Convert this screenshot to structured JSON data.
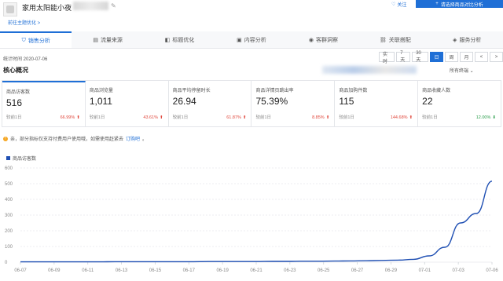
{
  "header": {
    "product_title": "家用太阳能小夜",
    "edit_icon": "edit-icon",
    "old_link": "前往主题优化 >",
    "follow_label": "关注",
    "compare_label": "请选择商品对比分析"
  },
  "tabs": [
    {
      "label": "销售分析",
      "icon": "shield-icon",
      "active": true
    },
    {
      "label": "流量来源",
      "icon": "flow-icon",
      "active": false
    },
    {
      "label": "标题优化",
      "icon": "tag-icon",
      "active": false
    },
    {
      "label": "内容分析",
      "icon": "content-icon",
      "active": false
    },
    {
      "label": "客群洞察",
      "icon": "people-icon",
      "active": false
    },
    {
      "label": "关联搭配",
      "icon": "link-icon",
      "active": false
    },
    {
      "label": "服务分析",
      "icon": "service-icon",
      "active": false
    }
  ],
  "toolbar": {
    "stat_time": "统计时间 2020-07-06",
    "ranges": [
      {
        "label": "实时",
        "active": false
      },
      {
        "label": "7天",
        "active": false
      },
      {
        "label": "30天",
        "active": false
      },
      {
        "label": "日",
        "active": true
      },
      {
        "label": "周",
        "active": false
      },
      {
        "label": "月",
        "active": false
      },
      {
        "label": "<",
        "active": false
      },
      {
        "label": ">",
        "active": false
      }
    ]
  },
  "section": {
    "title": "核心概况",
    "terminal_select": "所有终端 ⌄"
  },
  "metrics": [
    {
      "label": "商品访客数",
      "value": "516",
      "compare": "较前1日",
      "change": "66.99%",
      "dir": "up"
    },
    {
      "label": "商品浏览量",
      "value": "1,011",
      "compare": "较前1日",
      "change": "43.61%",
      "dir": "up"
    },
    {
      "label": "商品平均停留时长",
      "value": "26.94",
      "compare": "较前1日",
      "change": "61.87%",
      "dir": "up"
    },
    {
      "label": "商品详情页跳出率",
      "value": "75.39%",
      "compare": "较前1日",
      "change": "8.85%",
      "dir": "up"
    },
    {
      "label": "商品加购件数",
      "value": "115",
      "compare": "较前1日",
      "change": "144.68%",
      "dir": "up"
    },
    {
      "label": "商品收藏人数",
      "value": "22",
      "compare": "较前1日",
      "change": "12.00%",
      "dir": "down"
    }
  ],
  "notice": {
    "text": "亲，部分指标仅支持付费用户使用哦，如需使用赶紧去",
    "link": "订购吧",
    "tail": "。"
  },
  "colors": {
    "accent": "#1f6fd6",
    "line": "#1f4fb3",
    "up": "#e0463b",
    "down": "#2a9d4b"
  },
  "chart_data": {
    "type": "line",
    "title": "",
    "legend": "商品访客数",
    "legend_position": "top-left",
    "xlabel": "",
    "ylabel": "",
    "ylim": [
      0,
      600
    ],
    "yticks": [
      0,
      100,
      200,
      300,
      400,
      500,
      600
    ],
    "grid": true,
    "x_tick_labels": [
      "06-07",
      "06-09",
      "06-11",
      "06-13",
      "06-15",
      "06-17",
      "06-19",
      "06-21",
      "06-23",
      "06-25",
      "06-27",
      "06-29",
      "07-01",
      "07-03",
      "07-06"
    ],
    "x": [
      "06-07",
      "06-08",
      "06-09",
      "06-10",
      "06-11",
      "06-12",
      "06-13",
      "06-14",
      "06-15",
      "06-16",
      "06-17",
      "06-18",
      "06-19",
      "06-20",
      "06-21",
      "06-22",
      "06-23",
      "06-24",
      "06-25",
      "06-26",
      "06-27",
      "06-28",
      "06-29",
      "06-30",
      "07-01",
      "07-02",
      "07-03",
      "07-04",
      "07-05",
      "07-06"
    ],
    "series": [
      {
        "name": "商品访客数",
        "values": [
          2,
          2,
          2,
          2,
          2,
          2,
          3,
          3,
          3,
          3,
          3,
          3,
          4,
          4,
          4,
          4,
          5,
          5,
          6,
          6,
          7,
          8,
          9,
          11,
          13,
          18,
          40,
          95,
          250,
          310,
          516
        ]
      }
    ]
  }
}
